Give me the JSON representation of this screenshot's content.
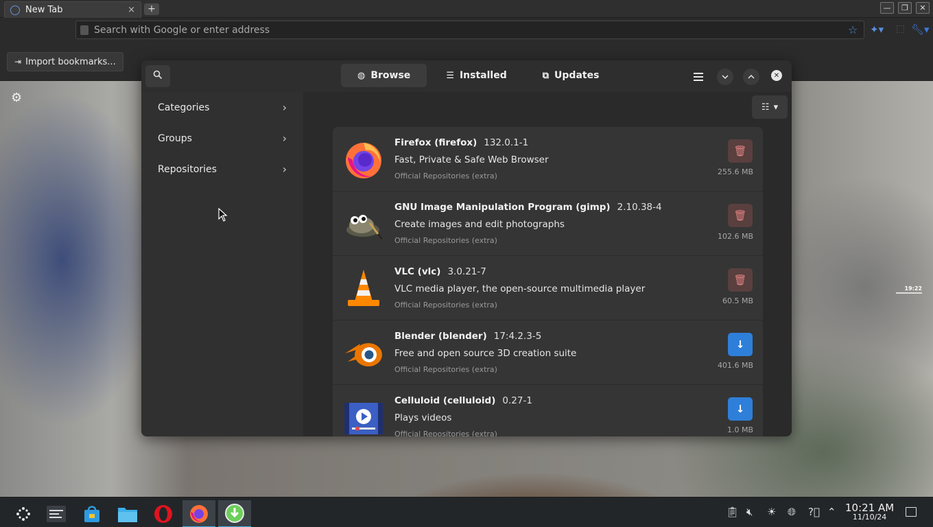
{
  "browser": {
    "tab_title": "New Tab",
    "tab_close": "×",
    "new_tab": "+",
    "address_placeholder": "Search with Google or enter address",
    "bookmark_import": "Import bookmarks..."
  },
  "app": {
    "tabs": [
      {
        "label": "Browse",
        "active": true
      },
      {
        "label": "Installed",
        "active": false
      },
      {
        "label": "Updates",
        "active": false
      }
    ],
    "sidebar": [
      {
        "label": "Categories"
      },
      {
        "label": "Groups"
      },
      {
        "label": "Repositories"
      }
    ],
    "packages": [
      {
        "name": "Firefox (firefox)",
        "version": "132.0.1-1",
        "description": "Fast, Private & Safe Web Browser",
        "repo": "Official Repositories (extra)",
        "size": "255.6 MB",
        "action": "remove"
      },
      {
        "name": "GNU Image Manipulation Program (gimp)",
        "version": "2.10.38-4",
        "description": "Create images and edit photographs",
        "repo": "Official Repositories (extra)",
        "size": "102.6 MB",
        "action": "remove"
      },
      {
        "name": "VLC (vlc)",
        "version": "3.0.21-7",
        "description": "VLC media player, the open-source multimedia player",
        "repo": "Official Repositories (extra)",
        "size": "60.5 MB",
        "action": "remove"
      },
      {
        "name": "Blender (blender)",
        "version": "17:4.2.3-5",
        "description": "Free and open source 3D creation suite",
        "repo": "Official Repositories (extra)",
        "size": "401.6 MB",
        "action": "install"
      },
      {
        "name": "Celluloid (celluloid)",
        "version": "0.27-1",
        "description": "Plays videos",
        "repo": "Official Repositories (extra)",
        "size": "1.0 MB",
        "action": "install"
      }
    ]
  },
  "taskbar": {
    "time": "10:21 AM",
    "date": "11/10/24"
  },
  "desktop": {
    "widget_time": "19:22"
  },
  "colors": {
    "accent": "#2e7fd9",
    "remove_bg": "#5a3f3f",
    "remove_fg": "#e28383",
    "panel_highlight": "#3daee9"
  }
}
